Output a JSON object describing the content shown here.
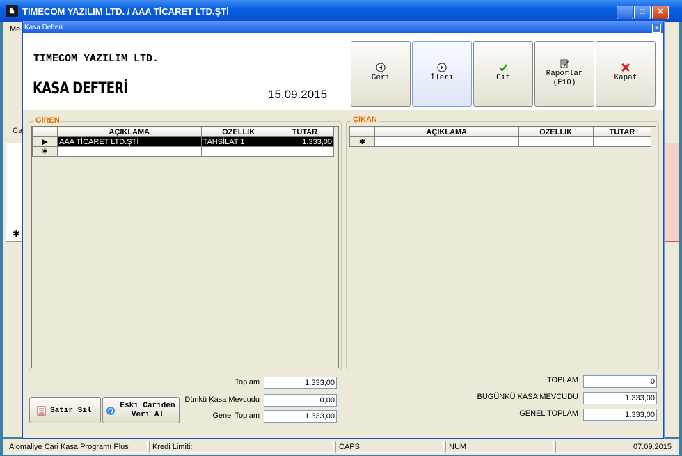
{
  "main_window": {
    "title": "TIMECOM YAZILIM LTD. / AAA TİCARET LTD.ŞTİ",
    "menu_first": "Me",
    "side_label": "Ca"
  },
  "dialog": {
    "title": "Kasa Defteri",
    "company": "TIMECOM YAZILIM LTD.",
    "heading": "KASA DEFTERİ",
    "date": "15.09.2015"
  },
  "toolbar": {
    "back": "Geri",
    "forward": "İleri",
    "go": "Git",
    "reports": "Raporlar\n(F10)",
    "close": "Kapat"
  },
  "giren": {
    "label": "GİREN",
    "columns": [
      "AÇIKLAMA",
      "OZELLIK",
      "TUTAR"
    ],
    "rows": [
      {
        "aciklama": "AAA TİCARET LTD.ŞTİ",
        "ozellik": "TAHSİLAT 1",
        "tutar": "1.333,00"
      }
    ],
    "new_row_marker": "✱",
    "current_row_marker": "▶"
  },
  "cikan": {
    "label": "ÇIKAN",
    "columns": [
      "AÇIKLAMA",
      "OZELLIK",
      "TUTAR"
    ],
    "new_row_marker": "✱"
  },
  "left_totals": {
    "toplam_label": "Toplam",
    "toplam": "1.333,00",
    "dunku_label": "Dünkü Kasa Mevcudu",
    "dunku": "0,00",
    "genel_label": "Genel Toplam",
    "genel": "1.333,00"
  },
  "right_totals": {
    "toplam_label": "TOPLAM",
    "toplam": "0",
    "bugunku_label": "BUGÜNKÜ KASA MEVCUDU",
    "bugunku": "1.333,00",
    "genel_label": "GENEL TOPLAM",
    "genel": "1.333,00"
  },
  "buttons": {
    "delete_row": "Satır Sil",
    "old_data": "Eski Cariden\nVeri Al"
  },
  "status_bar": {
    "app": "Alomaliye Cari Kasa Programı Plus",
    "credit": "Kredi Limiti:",
    "caps": "CAPS",
    "num": "NUM",
    "date": "07.09.2015"
  },
  "colors": {
    "title_bar": "#0a5fe0",
    "group_label": "#e46c00",
    "dialog_bg": "#ece9d8"
  }
}
